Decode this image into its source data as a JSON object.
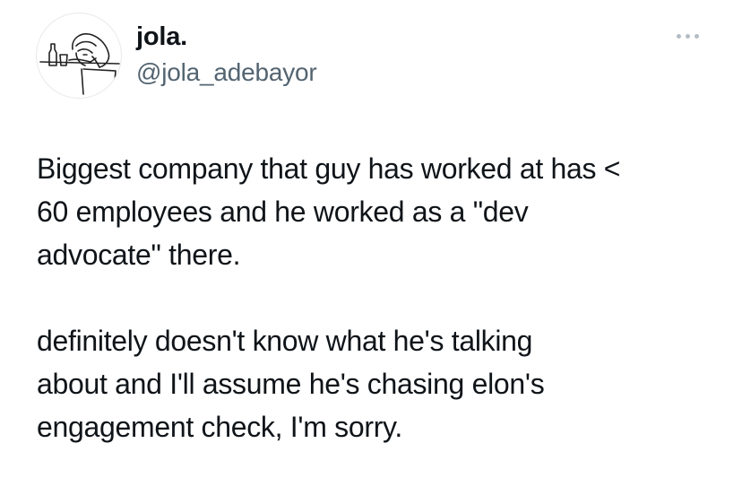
{
  "author": {
    "display_name": "jola.",
    "handle": "@jola_adebayor",
    "avatar_icon": "doodle-sketch-avatar"
  },
  "more_menu": {
    "icon": "more-horizontal-icon"
  },
  "tweet": {
    "paragraph_1": "Biggest company that guy has worked at has <\n60 employees and he worked as a \"dev\nadvocate\" there.",
    "paragraph_2": "definitely doesn't know what he's talking\nabout and I'll assume he's chasing elon's\nengagement check, I'm sorry."
  },
  "colors": {
    "text_primary": "#0f1419",
    "text_secondary": "#536471",
    "icon_muted": "#b4bdc4",
    "background": "#ffffff"
  }
}
